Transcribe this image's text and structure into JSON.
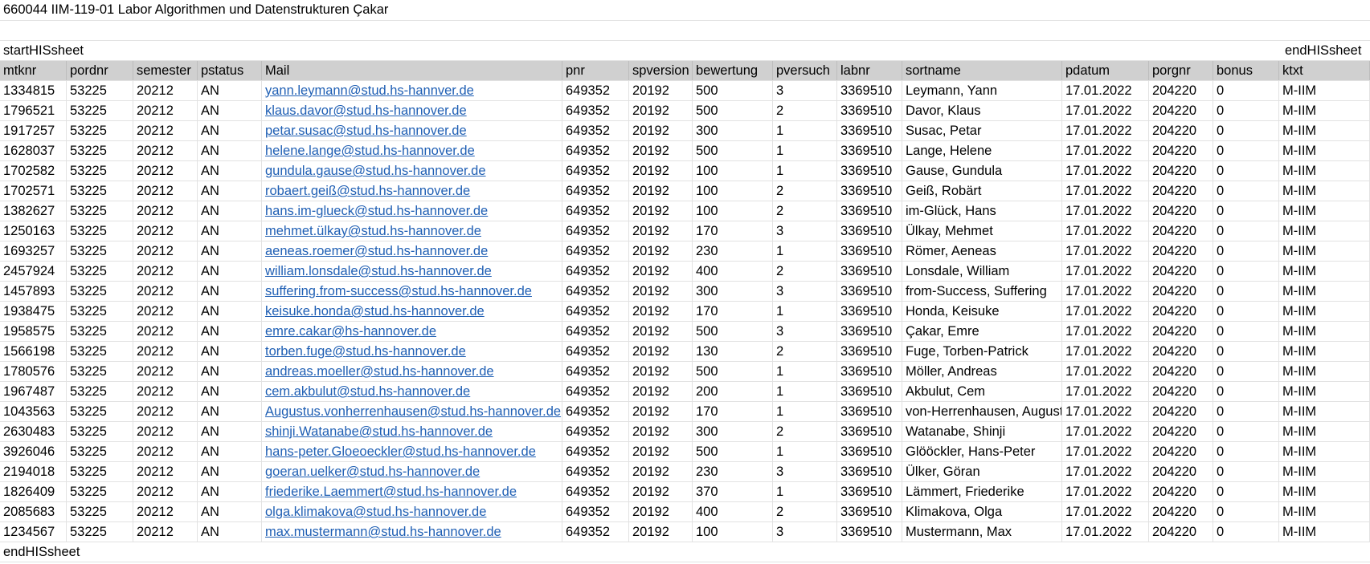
{
  "title_row": "660044  IIM-119-01  Labor Algorithmen und Datenstrukturen  Çakar",
  "start_marker": "startHISsheet",
  "end_marker_top": "endHISsheet",
  "end_marker_bottom": "endHISsheet",
  "link_color": "#1f5fb4",
  "header_bg": "#d0d0d0",
  "columns": [
    "mtknr",
    "pordnr",
    "semester",
    "pstatus",
    "Mail",
    "pnr",
    "spversion",
    "bewertung",
    "pversuch",
    "labnr",
    "sortname",
    "pdatum",
    "porgnr",
    "bonus",
    "ktxt"
  ],
  "rows": [
    [
      "1334815",
      "53225",
      "20212",
      "AN",
      "yann.leymann@stud.hs-hannver.de",
      "649352",
      "20192",
      "500",
      "3",
      "3369510",
      "Leymann, Yann",
      "17.01.2022",
      "204220",
      "0",
      "M-IIM"
    ],
    [
      "1796521",
      "53225",
      "20212",
      "AN",
      "klaus.davor@stud.hs-hannover.de",
      "649352",
      "20192",
      "500",
      "2",
      "3369510",
      "Davor, Klaus",
      "17.01.2022",
      "204220",
      "0",
      "M-IIM"
    ],
    [
      "1917257",
      "53225",
      "20212",
      "AN",
      "petar.susac@stud.hs-hannover.de",
      "649352",
      "20192",
      "300",
      "1",
      "3369510",
      "Susac, Petar",
      "17.01.2022",
      "204220",
      "0",
      "M-IIM"
    ],
    [
      "1628037",
      "53225",
      "20212",
      "AN",
      "helene.lange@stud.hs-hannover.de",
      "649352",
      "20192",
      "500",
      "1",
      "3369510",
      "Lange, Helene",
      "17.01.2022",
      "204220",
      "0",
      "M-IIM"
    ],
    [
      "1702582",
      "53225",
      "20212",
      "AN",
      "gundula.gause@stud.hs-hannover.de",
      "649352",
      "20192",
      "100",
      "1",
      "3369510",
      "Gause, Gundula",
      "17.01.2022",
      "204220",
      "0",
      "M-IIM"
    ],
    [
      "1702571",
      "53225",
      "20212",
      "AN",
      "robaert.geiß@stud.hs-hannover.de",
      "649352",
      "20192",
      "100",
      "2",
      "3369510",
      "Geiß, Robärt",
      "17.01.2022",
      "204220",
      "0",
      "M-IIM"
    ],
    [
      "1382627",
      "53225",
      "20212",
      "AN",
      "hans.im-glueck@stud.hs-hannover.de",
      "649352",
      "20192",
      "100",
      "2",
      "3369510",
      "im-Glück, Hans",
      "17.01.2022",
      "204220",
      "0",
      "M-IIM"
    ],
    [
      "1250163",
      "53225",
      "20212",
      "AN",
      "mehmet.ülkay@stud.hs-hannover.de",
      "649352",
      "20192",
      "170",
      "3",
      "3369510",
      "Ülkay, Mehmet",
      "17.01.2022",
      "204220",
      "0",
      "M-IIM"
    ],
    [
      "1693257",
      "53225",
      "20212",
      "AN",
      "aeneas.roemer@stud.hs-hannover.de",
      "649352",
      "20192",
      "230",
      "1",
      "3369510",
      "Römer, Aeneas",
      "17.01.2022",
      "204220",
      "0",
      "M-IIM"
    ],
    [
      "2457924",
      "53225",
      "20212",
      "AN",
      "william.lonsdale@stud.hs-hannover.de",
      "649352",
      "20192",
      "400",
      "2",
      "3369510",
      "Lonsdale, William",
      "17.01.2022",
      "204220",
      "0",
      "M-IIM"
    ],
    [
      "1457893",
      "53225",
      "20212",
      "AN",
      "suffering.from-success@stud.hs-hannover.de",
      "649352",
      "20192",
      "300",
      "3",
      "3369510",
      "from-Success, Suffering",
      "17.01.2022",
      "204220",
      "0",
      "M-IIM"
    ],
    [
      "1938475",
      "53225",
      "20212",
      "AN",
      "keisuke.honda@stud.hs-hannover.de",
      "649352",
      "20192",
      "170",
      "1",
      "3369510",
      "Honda, Keisuke",
      "17.01.2022",
      "204220",
      "0",
      "M-IIM"
    ],
    [
      "1958575",
      "53225",
      "20212",
      "AN",
      "emre.cakar@hs-hannover.de",
      "649352",
      "20192",
      "500",
      "3",
      "3369510",
      "Çakar, Emre",
      "17.01.2022",
      "204220",
      "0",
      "M-IIM"
    ],
    [
      "1566198",
      "53225",
      "20212",
      "AN",
      "torben.fuge@stud.hs-hannover.de",
      "649352",
      "20192",
      "130",
      "2",
      "3369510",
      "Fuge, Torben-Patrick",
      "17.01.2022",
      "204220",
      "0",
      "M-IIM"
    ],
    [
      "1780576",
      "53225",
      "20212",
      "AN",
      "andreas.moeller@stud.hs-hannover.de",
      "649352",
      "20192",
      "500",
      "1",
      "3369510",
      "Möller, Andreas",
      "17.01.2022",
      "204220",
      "0",
      "M-IIM"
    ],
    [
      "1967487",
      "53225",
      "20212",
      "AN",
      "cem.akbulut@stud.hs-hannover.de",
      "649352",
      "20192",
      "200",
      "1",
      "3369510",
      "Akbulut, Cem",
      "17.01.2022",
      "204220",
      "0",
      "M-IIM"
    ],
    [
      "1043563",
      "53225",
      "20212",
      "AN",
      "Augustus.vonherrenhausen@stud.hs-hannover.de",
      "649352",
      "20192",
      "170",
      "1",
      "3369510",
      "von-Herrenhausen, Augustus",
      "17.01.2022",
      "204220",
      "0",
      "M-IIM"
    ],
    [
      "2630483",
      "53225",
      "20212",
      "AN",
      "shinji.Watanabe@stud.hs-hannover.de",
      "649352",
      "20192",
      "300",
      "2",
      "3369510",
      "Watanabe, Shinji",
      "17.01.2022",
      "204220",
      "0",
      "M-IIM"
    ],
    [
      "3926046",
      "53225",
      "20212",
      "AN",
      "hans-peter.Gloeoeckler@stud.hs-hannover.de",
      "649352",
      "20192",
      "500",
      "1",
      "3369510",
      "Glööckler, Hans-Peter",
      "17.01.2022",
      "204220",
      "0",
      "M-IIM"
    ],
    [
      "2194018",
      "53225",
      "20212",
      "AN",
      "goeran.uelker@stud.hs-hannover.de",
      "649352",
      "20192",
      "230",
      "3",
      "3369510",
      "Ülker, Göran",
      "17.01.2022",
      "204220",
      "0",
      "M-IIM"
    ],
    [
      "1826409",
      "53225",
      "20212",
      "AN",
      "friederike.Laemmert@stud.hs-hannover.de",
      "649352",
      "20192",
      "370",
      "1",
      "3369510",
      "Lämmert, Friederike",
      "17.01.2022",
      "204220",
      "0",
      "M-IIM"
    ],
    [
      "2085683",
      "53225",
      "20212",
      "AN",
      "olga.klimakova@stud.hs-hannover.de",
      "649352",
      "20192",
      "400",
      "2",
      "3369510",
      "Klimakova, Olga",
      "17.01.2022",
      "204220",
      "0",
      "M-IIM"
    ],
    [
      "1234567",
      "53225",
      "20212",
      "AN",
      "max.mustermann@stud.hs-hannover.de",
      "649352",
      "20192",
      "100",
      "3",
      "3369510",
      "Mustermann, Max",
      "17.01.2022",
      "204220",
      "0",
      "M-IIM"
    ]
  ]
}
